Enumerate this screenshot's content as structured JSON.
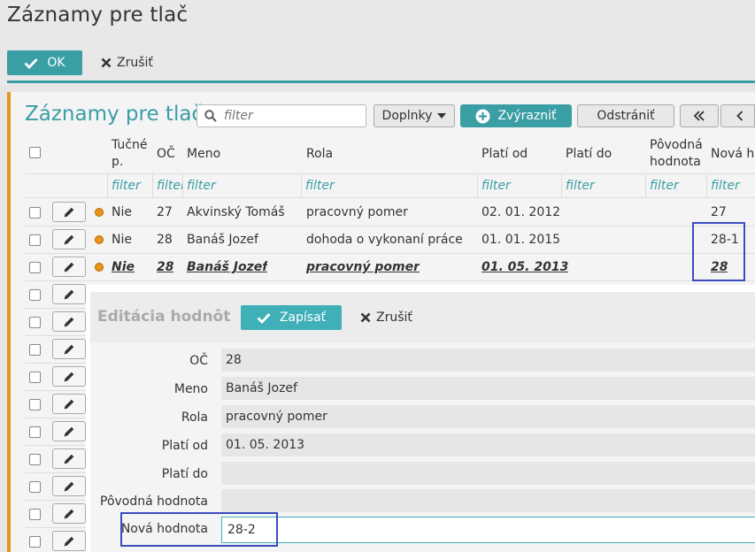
{
  "window": {
    "title": "Záznamy pre tlač",
    "ok_label": "OK",
    "cancel_label": "Zrušiť"
  },
  "panel": {
    "title": "Záznamy pre tlač",
    "search_placeholder": "filter",
    "doplnky_label": "Doplnky",
    "zvyraznit_label": "Zvýrazniť",
    "odstranit_label": "Odstrániť"
  },
  "table": {
    "headers": {
      "tucne": "Tučné p.",
      "oc": "OČ",
      "meno": "Meno",
      "rola": "Rola",
      "plati_od": "Platí od",
      "plati_do": "Platí do",
      "povodna": "Pôvodná hodnota",
      "nova": "Nová hodnota"
    },
    "filter": {
      "tucne": "filter",
      "oc": "filter",
      "meno": "filter",
      "rola": "filter",
      "plati_od": "filter",
      "plati_do": "filter",
      "povodna": "filter",
      "nova": "filter"
    },
    "rows": [
      {
        "tucne": "Nie",
        "oc": "27",
        "meno": "Akvinský Tomáš",
        "rola": "pracovný pomer",
        "plati_od": "02. 01. 2012",
        "plati_do": "",
        "povodna": "",
        "nova": "27"
      },
      {
        "tucne": "Nie",
        "oc": "28",
        "meno": "Banáš Jozef",
        "rola": "dohoda o vykonaní práce",
        "plati_od": "01. 01. 2015",
        "plati_do": "",
        "povodna": "",
        "nova": "28-1"
      },
      {
        "tucne": "Nie",
        "oc": "28",
        "meno": "Banáš Jozef",
        "rola": "pracovný pomer",
        "plati_od": "01. 05. 2013",
        "plati_do": "",
        "povodna": "",
        "nova": "28"
      }
    ]
  },
  "dialog": {
    "title": "Editácia hodnôt",
    "save_label": "Zapísať",
    "cancel_label": "Zrušiť",
    "fields": {
      "oc": {
        "label": "OČ",
        "value": "28"
      },
      "meno": {
        "label": "Meno",
        "value": "Banáš Jozef"
      },
      "rola": {
        "label": "Rola",
        "value": "pracovný pomer"
      },
      "plati_od": {
        "label": "Platí od",
        "value": "01. 05. 2013"
      },
      "plati_do": {
        "label": "Platí do",
        "value": ""
      },
      "povodna": {
        "label": "Pôvodná hodnota",
        "value": ""
      },
      "nova": {
        "label": "Nová hodnota",
        "value": "28-2"
      }
    }
  },
  "colors": {
    "accent": "#3a9ea5",
    "orange": "#e8941a",
    "highlight": "#3a4cc0"
  }
}
